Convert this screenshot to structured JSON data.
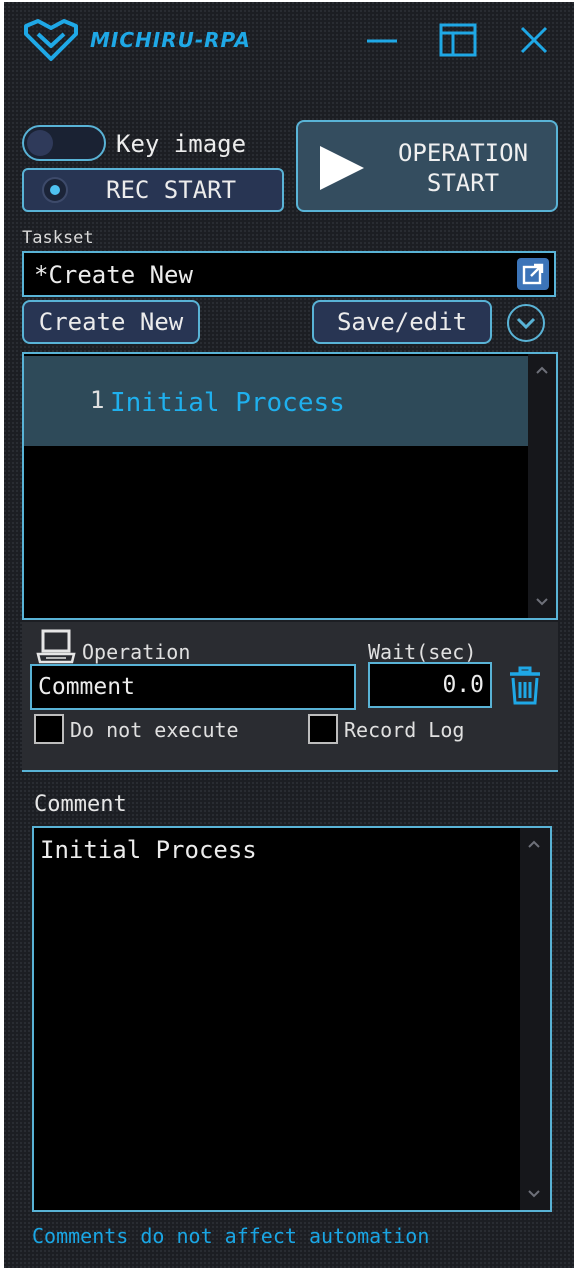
{
  "app": {
    "brand": "MICHIRU-RPA",
    "accent_color": "#1fa8e6",
    "window_controls": {
      "minimize_icon": "minimize-icon",
      "maximize_icon": "restore-window-icon",
      "close_icon": "close-icon"
    }
  },
  "top_controls": {
    "key_image_label": "Key image",
    "key_image_enabled": false,
    "rec_start_label": "REC START",
    "operation_start_line1": "OPERATION",
    "operation_start_line2": "START"
  },
  "taskset": {
    "label": "Taskset",
    "value": "*Create New",
    "create_new_label": "Create New",
    "save_edit_label": "Save/edit"
  },
  "tasks": [
    {
      "number": "1",
      "name": "Initial Process",
      "selected": true
    }
  ],
  "operation": {
    "label": "Operation",
    "value": "Comment",
    "wait_label": "Wait(sec)",
    "wait_value": "0.0",
    "do_not_execute_label": "Do not execute",
    "do_not_execute_checked": false,
    "record_log_label": "Record Log",
    "record_log_checked": false
  },
  "comment": {
    "label": "Comment",
    "value": "Initial Process",
    "hint": "Comments do not affect automation"
  }
}
